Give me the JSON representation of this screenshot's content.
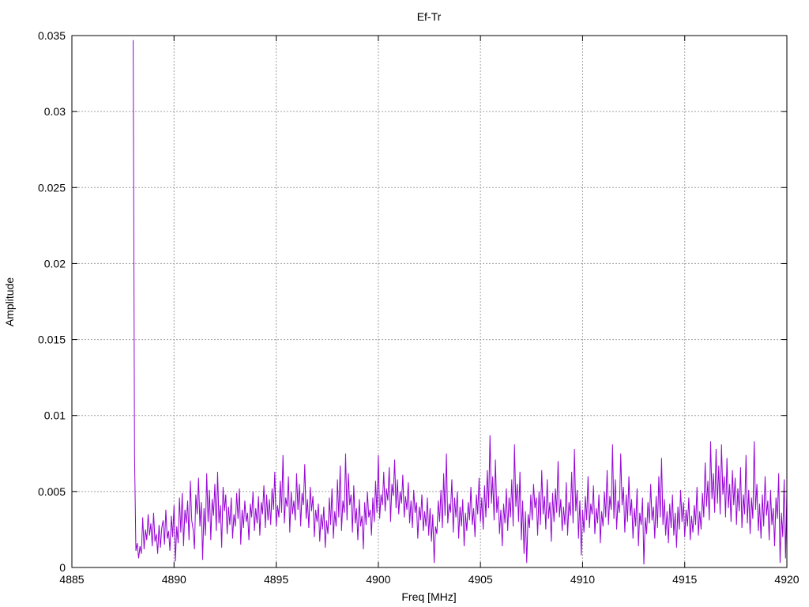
{
  "chart_data": {
    "type": "line",
    "title": "Ef-Tr",
    "xlabel": "Freq [MHz]",
    "ylabel": "Amplitude",
    "xlim": [
      4885,
      4920
    ],
    "ylim": [
      0,
      0.035
    ],
    "x_ticks": [
      "4885",
      "4890",
      "4895",
      "4900",
      "4905",
      "4910",
      "4915",
      "4920"
    ],
    "y_ticks": [
      "0",
      "0.005",
      "0.01",
      "0.015",
      "0.02",
      "0.025",
      "0.03",
      "0.035"
    ],
    "grid": true,
    "legend": "none",
    "colors": {
      "series": "#9400d3",
      "grid": "#a0a0a0",
      "axis": "#000000"
    },
    "series": [
      {
        "x_start": 4888,
        "x_end": 4920,
        "x_step": 0.025,
        "values": [
          0.0347,
          0.0074,
          0.0011,
          0.0016,
          0.0006,
          0.0014,
          0.0009,
          0.0033,
          0.0012,
          0.0025,
          0.0018,
          0.0035,
          0.0021,
          0.0029,
          0.0014,
          0.0036,
          0.0017,
          0.0022,
          0.0009,
          0.0028,
          0.0013,
          0.0026,
          0.0031,
          0.0015,
          0.0038,
          0.0019,
          0.0024,
          0.0011,
          0.0034,
          0.002,
          0.0041,
          0.0004,
          0.0027,
          0.0016,
          0.0046,
          0.0023,
          0.0049,
          0.0014,
          0.0038,
          0.0029,
          0.0044,
          0.0018,
          0.0057,
          0.0031,
          0.0025,
          0.0012,
          0.0048,
          0.0035,
          0.0059,
          0.0027,
          0.0043,
          0.0005,
          0.0039,
          0.0021,
          0.0062,
          0.003,
          0.0051,
          0.0018,
          0.0045,
          0.0034,
          0.0055,
          0.0024,
          0.0063,
          0.0029,
          0.0041,
          0.0013,
          0.0053,
          0.0037,
          0.0048,
          0.0022,
          0.004,
          0.0028,
          0.0046,
          0.0019,
          0.0035,
          0.0027,
          0.0049,
          0.0032,
          0.0052,
          0.0015,
          0.0038,
          0.0026,
          0.0044,
          0.003,
          0.0036,
          0.0018,
          0.0042,
          0.0033,
          0.005,
          0.0024,
          0.0039,
          0.0029,
          0.0047,
          0.0021,
          0.0043,
          0.0035,
          0.0054,
          0.0026,
          0.0048,
          0.0031,
          0.0045,
          0.0028,
          0.0052,
          0.0038,
          0.0063,
          0.0027,
          0.0041,
          0.0033,
          0.0057,
          0.0036,
          0.0074,
          0.0029,
          0.0046,
          0.004,
          0.006,
          0.0023,
          0.005,
          0.0035,
          0.0044,
          0.0031,
          0.0062,
          0.0038,
          0.0055,
          0.0027,
          0.0049,
          0.0041,
          0.0068,
          0.0032,
          0.0045,
          0.0026,
          0.0053,
          0.0037,
          0.0047,
          0.002,
          0.0038,
          0.003,
          0.0042,
          0.0017,
          0.0035,
          0.0025,
          0.004,
          0.0013,
          0.0031,
          0.0022,
          0.0046,
          0.0028,
          0.0052,
          0.0019,
          0.0037,
          0.0027,
          0.0058,
          0.0033,
          0.0067,
          0.0024,
          0.0044,
          0.0036,
          0.0075,
          0.0031,
          0.0062,
          0.0041,
          0.0048,
          0.0023,
          0.0054,
          0.0029,
          0.0039,
          0.0018,
          0.0045,
          0.0027,
          0.0034,
          0.0012,
          0.0043,
          0.0028,
          0.005,
          0.0033,
          0.0038,
          0.0021,
          0.0046,
          0.003,
          0.0057,
          0.0036,
          0.0074,
          0.0032,
          0.0048,
          0.0041,
          0.0063,
          0.0037,
          0.0052,
          0.0044,
          0.0066,
          0.003,
          0.0055,
          0.0047,
          0.0071,
          0.0039,
          0.0058,
          0.0035,
          0.005,
          0.0042,
          0.0061,
          0.0033,
          0.0047,
          0.0038,
          0.0056,
          0.0029,
          0.0044,
          0.0026,
          0.0051,
          0.0036,
          0.0043,
          0.0019,
          0.004,
          0.0031,
          0.0048,
          0.0024,
          0.0037,
          0.0027,
          0.0046,
          0.0021,
          0.0039,
          0.0017,
          0.0035,
          0.0003,
          0.0027,
          0.0022,
          0.0044,
          0.003,
          0.0051,
          0.0026,
          0.0062,
          0.0034,
          0.0075,
          0.0029,
          0.0042,
          0.0036,
          0.0058,
          0.0023,
          0.0046,
          0.0033,
          0.005,
          0.0019,
          0.004,
          0.0027,
          0.0045,
          0.0014,
          0.0036,
          0.0024,
          0.0043,
          0.0031,
          0.0053,
          0.0028,
          0.0039,
          0.002,
          0.0048,
          0.0035,
          0.0059,
          0.003,
          0.0046,
          0.0025,
          0.0054,
          0.0033,
          0.0064,
          0.0039,
          0.0087,
          0.0042,
          0.006,
          0.0031,
          0.0071,
          0.0036,
          0.0047,
          0.0022,
          0.0038,
          0.0014,
          0.0042,
          0.0029,
          0.0052,
          0.0024,
          0.0046,
          0.0033,
          0.0058,
          0.0027,
          0.0081,
          0.004,
          0.0055,
          0.003,
          0.0063,
          0.0018,
          0.0044,
          0.0009,
          0.0037,
          0.0003,
          0.0035,
          0.0026,
          0.0048,
          0.0031,
          0.0055,
          0.0039,
          0.0046,
          0.0021,
          0.005,
          0.0028,
          0.0064,
          0.0035,
          0.0047,
          0.0025,
          0.0058,
          0.0032,
          0.0043,
          0.0017,
          0.0049,
          0.003,
          0.0052,
          0.0036,
          0.007,
          0.0033,
          0.0045,
          0.0024,
          0.004,
          0.0028,
          0.0056,
          0.0021,
          0.0043,
          0.0034,
          0.0063,
          0.0029,
          0.0078,
          0.0037,
          0.0051,
          0.0019,
          0.0044,
          0.0008,
          0.0038,
          0.0023,
          0.0047,
          0.0031,
          0.006,
          0.0026,
          0.0042,
          0.0035,
          0.0054,
          0.0022,
          0.0039,
          0.0029,
          0.0048,
          0.0016,
          0.0037,
          0.0027,
          0.005,
          0.0033,
          0.0064,
          0.0028,
          0.0047,
          0.0038,
          0.0081,
          0.0032,
          0.0058,
          0.0025,
          0.0044,
          0.0036,
          0.0075,
          0.0041,
          0.0053,
          0.0023,
          0.0048,
          0.003,
          0.006,
          0.0034,
          0.0045,
          0.0019,
          0.0039,
          0.0027,
          0.0052,
          0.0014,
          0.0036,
          0.0028,
          0.0046,
          0.0002,
          0.0033,
          0.0022,
          0.0043,
          0.0029,
          0.0055,
          0.0031,
          0.004,
          0.0019,
          0.0047,
          0.0026,
          0.006,
          0.0033,
          0.0072,
          0.0028,
          0.0045,
          0.0021,
          0.0037,
          0.0016,
          0.0042,
          0.0026,
          0.0048,
          0.0021,
          0.0036,
          0.0013,
          0.004,
          0.0025,
          0.0051,
          0.003,
          0.0043,
          0.002,
          0.0038,
          0.0027,
          0.0046,
          0.0018,
          0.0034,
          0.0023,
          0.0041,
          0.0028,
          0.0053,
          0.0021,
          0.0037,
          0.0025,
          0.0049,
          0.0033,
          0.0069,
          0.004,
          0.0057,
          0.0031,
          0.0083,
          0.0045,
          0.0062,
          0.0036,
          0.0078,
          0.0042,
          0.0067,
          0.0035,
          0.0081,
          0.0048,
          0.006,
          0.0033,
          0.0072,
          0.0039,
          0.0055,
          0.003,
          0.0064,
          0.0041,
          0.0059,
          0.0028,
          0.0052,
          0.0037,
          0.0066,
          0.0026,
          0.0048,
          0.0035,
          0.0074,
          0.0029,
          0.0051,
          0.0022,
          0.0046,
          0.0032,
          0.0083,
          0.0038,
          0.0055,
          0.0024,
          0.0042,
          0.0019,
          0.0048,
          0.0027,
          0.006,
          0.0034,
          0.0044,
          0.0018,
          0.0051,
          0.0028,
          0.0039,
          0.0014,
          0.0046,
          0.0032,
          0.0062,
          0.0003,
          0.0036,
          0.002,
          0.0058,
          0.0006,
          0.0049
        ]
      }
    ]
  }
}
